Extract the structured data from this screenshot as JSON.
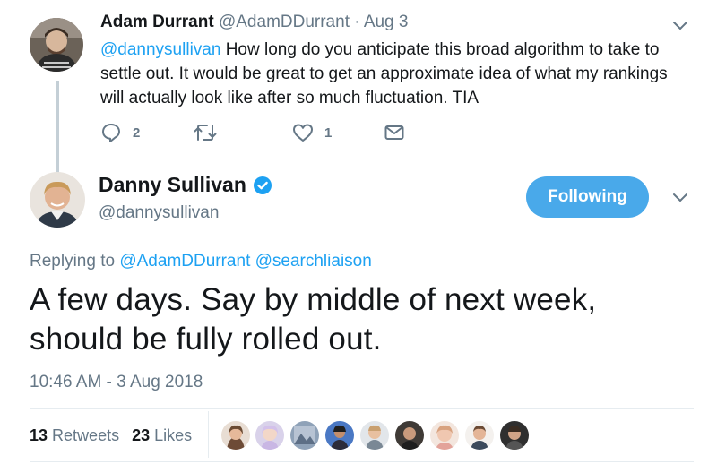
{
  "parent_tweet": {
    "name": "Adam Durrant",
    "handle": "@AdamDDurrant",
    "separator": "·",
    "date": "Aug 3",
    "mention": "@dannysullivan",
    "text": " How long do you anticipate this broad algorithm to take to settle out. It would be great to get an approximate idea of what my rankings will actually look like after so much fluctuation. TIA",
    "reply_count": "2",
    "like_count": "1",
    "icons": [
      "reply-icon",
      "retweet-icon",
      "like-icon",
      "message-icon",
      "chevron-down-icon"
    ]
  },
  "main_tweet": {
    "name": "Danny Sullivan",
    "handle": "@dannysullivan",
    "follow_label": "Following",
    "replying_prefix": "Replying to",
    "replying_users": "@AdamDDurrant @searchliaison",
    "text": "A few days. Say by middle of next week, should be fully rolled out.",
    "timestamp": "10:46 AM - 3 Aug 2018",
    "retweets_count": "13",
    "retweets_label": "Retweets",
    "likes_count": "23",
    "likes_label": "Likes",
    "liker_count": 9
  },
  "colors": {
    "accent": "#1da1f2",
    "button": "#49a9ea",
    "muted": "#657786",
    "text": "#14171a",
    "divider": "#e6ecf0",
    "thread_line": "#c4cfd6"
  }
}
